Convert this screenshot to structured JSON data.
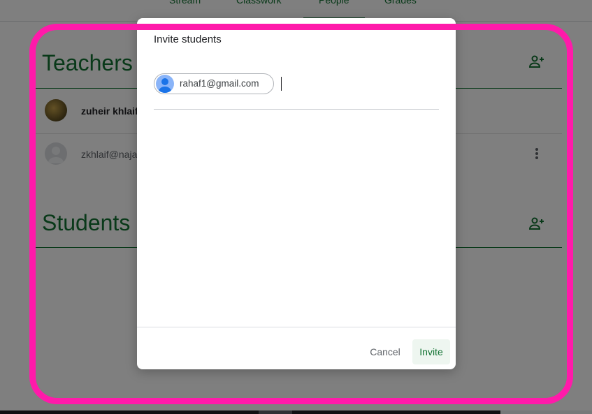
{
  "nav": {
    "tabs": [
      {
        "label": "Stream"
      },
      {
        "label": "Classwork"
      },
      {
        "label": "People"
      },
      {
        "label": "Grades"
      }
    ]
  },
  "teachers": {
    "title": "Teachers",
    "rows": [
      {
        "name": "zuheir khlaif"
      },
      {
        "name": "zkhlaif@naja"
      }
    ]
  },
  "students": {
    "title": "Students"
  },
  "dialog": {
    "title": "Invite students",
    "chips": [
      {
        "label": "rahaf1@gmail.com"
      }
    ],
    "cancel_label": "Cancel",
    "invite_label": "Invite"
  },
  "colors": {
    "accent": "#137333",
    "annotation": "#ff1aaa"
  },
  "icons": [
    "add-person-icon",
    "more-vert-icon",
    "avatar-icon"
  ]
}
